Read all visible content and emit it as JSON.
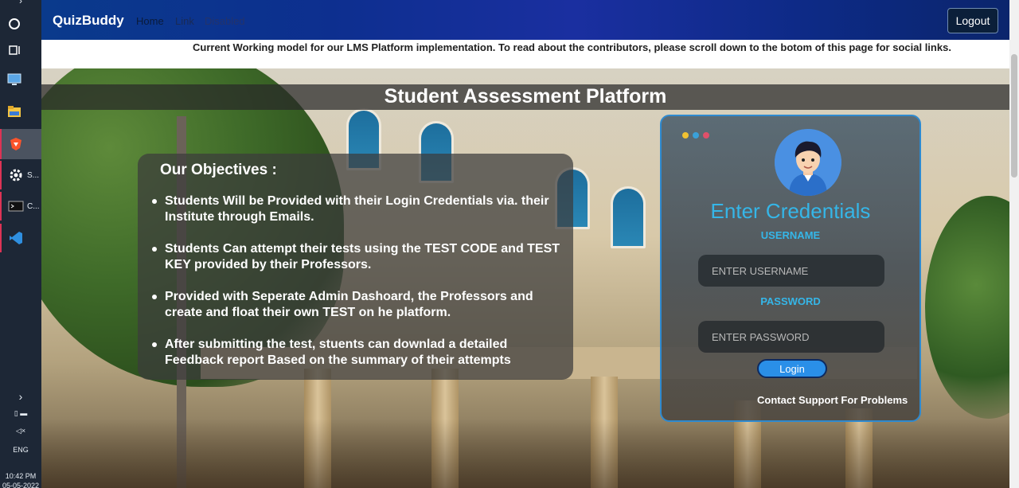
{
  "taskbar": {
    "items": [
      {
        "icon": "circle-icon",
        "label": ""
      },
      {
        "icon": "task-view-icon",
        "label": ""
      },
      {
        "icon": "computer-icon",
        "label": ""
      },
      {
        "icon": "folder-icon",
        "label": ""
      },
      {
        "icon": "brave-icon",
        "label": ""
      },
      {
        "icon": "gear-icon",
        "label": "S..."
      },
      {
        "icon": "terminal-icon",
        "label": "C..."
      },
      {
        "icon": "vscode-icon",
        "label": ""
      }
    ],
    "language": "ENG",
    "time": "10:42 PM",
    "date": "05-05-2022"
  },
  "navbar": {
    "brand": "QuizBuddy",
    "links": [
      "Home",
      "Link",
      "Disabled"
    ],
    "logout_label": "Logout",
    "link_colors": [
      "#0b1b3a",
      "#1a2a55",
      "#24336b"
    ]
  },
  "infobar": {
    "text": "Current Working model for our LMS Platform implementation.   To read about the contributors, please scroll down to the botom of this page for social links."
  },
  "hero": {
    "title": "Student Assessment Platform"
  },
  "objectives": {
    "title": "Our Objectives :",
    "items": [
      "Students Will be Provided with their Login Credentials via. their Institute through Emails.",
      "Students Can attempt their tests using the TEST CODE and TEST KEY provided by their Professors.",
      "Provided with Seperate Admin Dashoard, the Professors and create and float their own TEST on he platform.",
      "After submitting the test, stuents can downlad a detailed Feedback report Based on the summary of their attempts"
    ]
  },
  "login": {
    "title": "Enter Credentials",
    "username_label": "USERNAME",
    "username_placeholder": "ENTER USERNAME",
    "password_label": "PASSWORD",
    "password_placeholder": "ENTER PASSWORD",
    "button_label": "Login",
    "support_text": "Contact Support For Problems",
    "dot_colors": [
      "#f1c232",
      "#3aa0d8",
      "#e0506a"
    ],
    "accent": "#35b6e8"
  }
}
